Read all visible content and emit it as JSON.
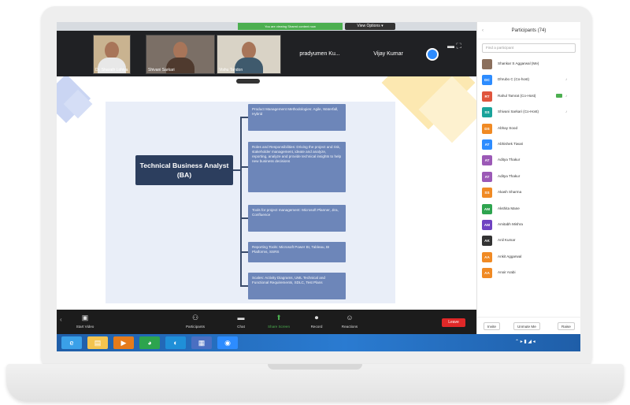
{
  "share_bar": {
    "status": "You are viewing Shared content now",
    "options_label": "View Options ▾"
  },
  "videos": [
    {
      "name": "Dr. Sharath Lohiya"
    },
    {
      "name": "Shivani Sarkari"
    },
    {
      "name": "Vishu Tandon"
    }
  ],
  "name_tiles": [
    "pradyumen Ku...",
    "Vijay Kumar"
  ],
  "mindmap": {
    "root": "Technical Business Analyst (BA)",
    "nodes": [
      "Product Management Methodologies: Agile, Waterfall, Hybrid",
      "Roles and Responsibilities: Driving the project and risk, stakeholder management, ideate and analyze, reporting, analyze and provide technical insights to help new business decisions",
      "Tools for project management: Microsoft Planner, Jira, Confluence",
      "Reporting Tools: Microsoft Power BI, Tableau, BI Platforms, SSRS",
      "Scales: Activity Diagrams, UML Technical and Functional Requirements, SDLC, Test Plans"
    ]
  },
  "toolbar": {
    "items": [
      {
        "icon": "▣",
        "label": "Start Video"
      },
      {
        "icon": "⚇",
        "label": "Participants"
      },
      {
        "icon": "▬",
        "label": "Chat"
      },
      {
        "icon": "⬆",
        "label": "Share Screen"
      },
      {
        "icon": "⏺",
        "label": "Record"
      },
      {
        "icon": "☺",
        "label": "Reactions"
      }
    ],
    "end_label": "Leave"
  },
  "participants": {
    "title": "Participants (74)",
    "search_placeholder": "Find a participant",
    "list": [
      {
        "initials": "",
        "name": "Shankar S Aggarwal (Me)",
        "color": "#8b6f5c"
      },
      {
        "initials": "DC",
        "name": "Dhrubo C (Co-host)",
        "color": "#2d8cff"
      },
      {
        "initials": "RT",
        "name": "Rahul Tamrat (Co-Host)",
        "color": "#e0553d"
      },
      {
        "initials": "SS",
        "name": "Shivani Sarkari (Co-Host)",
        "color": "#19a39a"
      },
      {
        "initials": "DS",
        "name": "Abhay Sood",
        "color": "#f08a24"
      },
      {
        "initials": "AT",
        "name": "Abhishek Tiwari",
        "color": "#2d8cff"
      },
      {
        "initials": "AT",
        "name": "Aditya Thakur",
        "color": "#9b59b6"
      },
      {
        "initials": "AT",
        "name": "Aditya Thakur",
        "color": "#9b59b6"
      },
      {
        "initials": "SS",
        "name": "Akash Sharma",
        "color": "#f08a24"
      },
      {
        "initials": "AM",
        "name": "Akshita Mane",
        "color": "#2ea44f"
      },
      {
        "initials": "AM",
        "name": "Amitabh Mishra",
        "color": "#6f42c1"
      },
      {
        "initials": "AK",
        "name": "Anil Kumar",
        "color": "#333333"
      },
      {
        "initials": "AA",
        "name": "Ankit Aggarwal",
        "color": "#f08a24"
      },
      {
        "initials": "AA",
        "name": "Anoir Arabi",
        "color": "#f08a24"
      }
    ],
    "footer": [
      "Invite",
      "Unmute Me",
      "Raise"
    ]
  },
  "taskbar": {
    "icons": [
      {
        "glyph": "e",
        "color": "#3aa0e8"
      },
      {
        "glyph": "▤",
        "color": "#f3c44f"
      },
      {
        "glyph": "▶",
        "color": "#e57b1b"
      },
      {
        "glyph": "◕",
        "color": "#2da44e"
      },
      {
        "glyph": "◐",
        "color": "#1f8fd8"
      },
      {
        "glyph": "▦",
        "color": "#4a6fc2"
      },
      {
        "glyph": "◉",
        "color": "#2d8cff"
      }
    ],
    "tray": "⌃ ▸ ▮ ◢ ◂"
  }
}
